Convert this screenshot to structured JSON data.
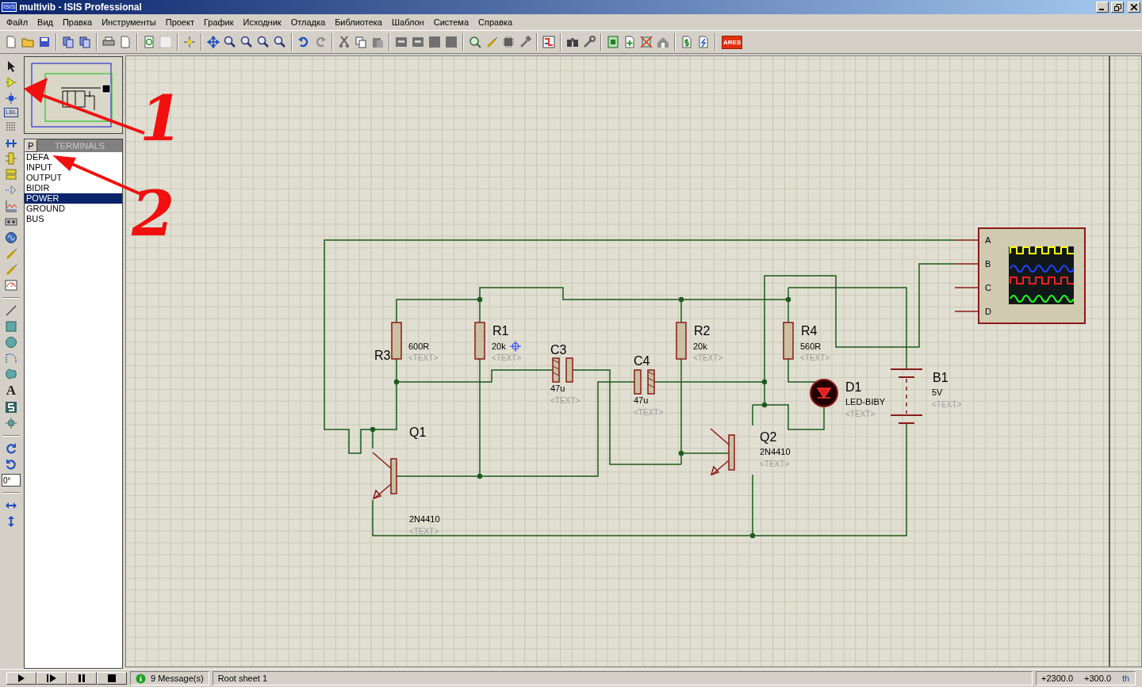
{
  "window": {
    "logo": "ISIS",
    "title": "multivib - ISIS Professional"
  },
  "menu": [
    "Файл",
    "Вид",
    "Правка",
    "Инструменты",
    "Проект",
    "График",
    "Исходник",
    "Отладка",
    "Библиотека",
    "Шаблон",
    "Система",
    "Справка"
  ],
  "toolbar": {
    "logo": "ARES"
  },
  "tools": {
    "label_tool": "LBL",
    "text_tool": "A",
    "angle": "0°"
  },
  "selector": {
    "mode_button": "P",
    "title": "TERMINALS",
    "items": [
      {
        "label": "DEFA",
        "selected": false
      },
      {
        "label": "INPUT",
        "selected": false
      },
      {
        "label": "OUTPUT",
        "selected": false
      },
      {
        "label": "BIDIR",
        "selected": false
      },
      {
        "label": "POWER",
        "selected": true
      },
      {
        "label": "GROUND",
        "selected": false
      },
      {
        "label": "BUS",
        "selected": false
      }
    ]
  },
  "schematic": {
    "components": [
      {
        "kind": "resistor",
        "name": "R3",
        "value": "600R",
        "text": "<TEXT>"
      },
      {
        "kind": "resistor",
        "name": "R1",
        "value": "20k",
        "text": "<TEXT>"
      },
      {
        "kind": "capacitor",
        "name": "C3",
        "value": "47u",
        "text": "<TEXT>"
      },
      {
        "kind": "capacitor",
        "name": "C4",
        "value": "47u",
        "text": "<TEXT>"
      },
      {
        "kind": "resistor",
        "name": "R2",
        "value": "20k",
        "text": "<TEXT>"
      },
      {
        "kind": "resistor",
        "name": "R4",
        "value": "560R",
        "text": "<TEXT>"
      },
      {
        "kind": "led",
        "name": "D1",
        "value": "LED-BIBY",
        "text": "<TEXT>"
      },
      {
        "kind": "battery",
        "name": "B1",
        "value": "5V",
        "text": "<TEXT>"
      },
      {
        "kind": "transistor",
        "name": "Q1",
        "value": "2N4410",
        "text": "<TEXT>"
      },
      {
        "kind": "transistor",
        "name": "Q2",
        "value": "2N4410",
        "text": "<TEXT>"
      }
    ],
    "oscilloscope": {
      "channels": [
        {
          "label": "A",
          "color": "#ffff00"
        },
        {
          "label": "B",
          "color": "#2040ff"
        },
        {
          "label": "C",
          "color": "#ff2020"
        },
        {
          "label": "D",
          "color": "#20ff20"
        }
      ]
    }
  },
  "status_bar": {
    "messages": "9 Message(s)",
    "sheet": "Root sheet 1",
    "x": "+2300.0",
    "y": "+300.0",
    "units": "th"
  },
  "annotations": [
    "1",
    "2"
  ]
}
